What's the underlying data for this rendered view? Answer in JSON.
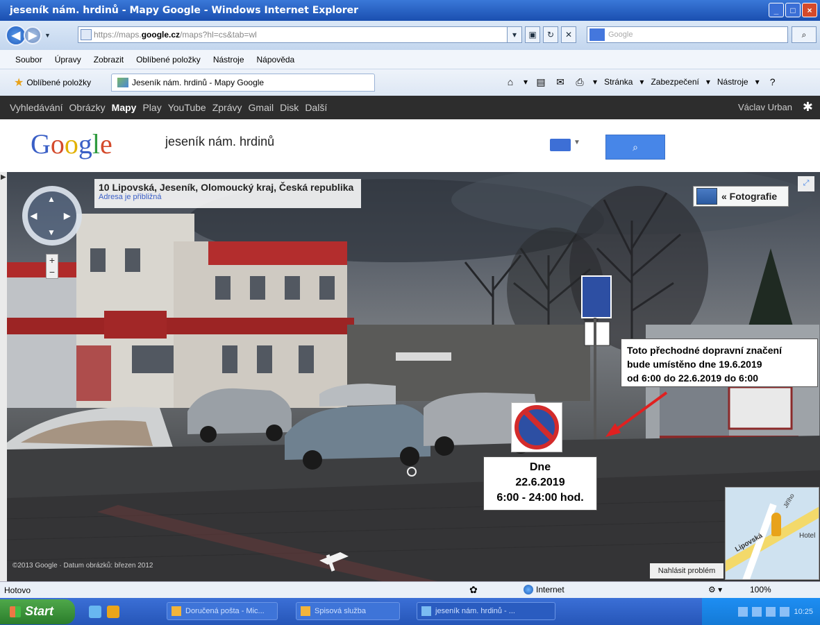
{
  "window": {
    "title": "jeseník nám. hrdinů - Mapy Google - Windows Internet Explorer"
  },
  "address_bar": {
    "url_prefix": "https://maps.",
    "url_domain": "google.cz",
    "url_rest": "/maps?hl=cs&tab=wl",
    "search_placeholder": "Google"
  },
  "menu": {
    "items": [
      "Soubor",
      "Úpravy",
      "Zobrazit",
      "Oblíbené položky",
      "Nástroje",
      "Nápověda"
    ]
  },
  "favorites_bar": {
    "favorites_label": "Oblíbené položky",
    "tab_title": "Jeseník nám. hrdinů - Mapy Google",
    "commands": [
      "Stránka",
      "Zabezpečení",
      "Nástroje"
    ]
  },
  "google_bar": {
    "items": [
      "Vyhledávání",
      "Obrázky",
      "Mapy",
      "Play",
      "YouTube",
      "Zprávy",
      "Gmail",
      "Disk",
      "Další"
    ],
    "active": "Mapy",
    "user": "Václav Urban"
  },
  "google_header": {
    "logo": [
      "G",
      "o",
      "o",
      "g",
      "l",
      "e"
    ],
    "query": "jeseník nám. hrdinů"
  },
  "street_view": {
    "address": "10 Lipovská, Jeseník, Olomoucký kraj, Česká republika",
    "address_note": "Adresa je přibližná",
    "photos_button": "« Fotografie",
    "copyright": "©2013 Google · Datum obrázků: březen 2012",
    "report_problem": "Nahlásit problém",
    "minimap_labels": [
      "Lipovská",
      "Hotel",
      "Jiřího"
    ]
  },
  "annotations": {
    "note_top_lines": [
      "Toto přechodné dopravní značení",
      "bude umístěno dne 19.6.2019",
      "od 6:00 do 22.6.2019 do 6:00"
    ],
    "note_bottom_lines": [
      "Dne",
      "22.6.2019",
      "6:00 - 24:00 hod."
    ]
  },
  "status_bar": {
    "status": "Hotovo",
    "zone": "Internet",
    "zoom": "100%"
  },
  "taskbar": {
    "start": "Start",
    "items": [
      "Doručená pošta - Mic...",
      "Spisová služba",
      "jeseník nám. hrdinů - ..."
    ],
    "clock": "10:25"
  },
  "colors": {
    "title_blue": "#1a4fb0",
    "google_dark_bar": "#2d2d2d",
    "search_button": "#4786e8",
    "sign_red": "#d32b2b",
    "sign_blue": "#2d4fa3",
    "arrow_red": "#e02020"
  }
}
